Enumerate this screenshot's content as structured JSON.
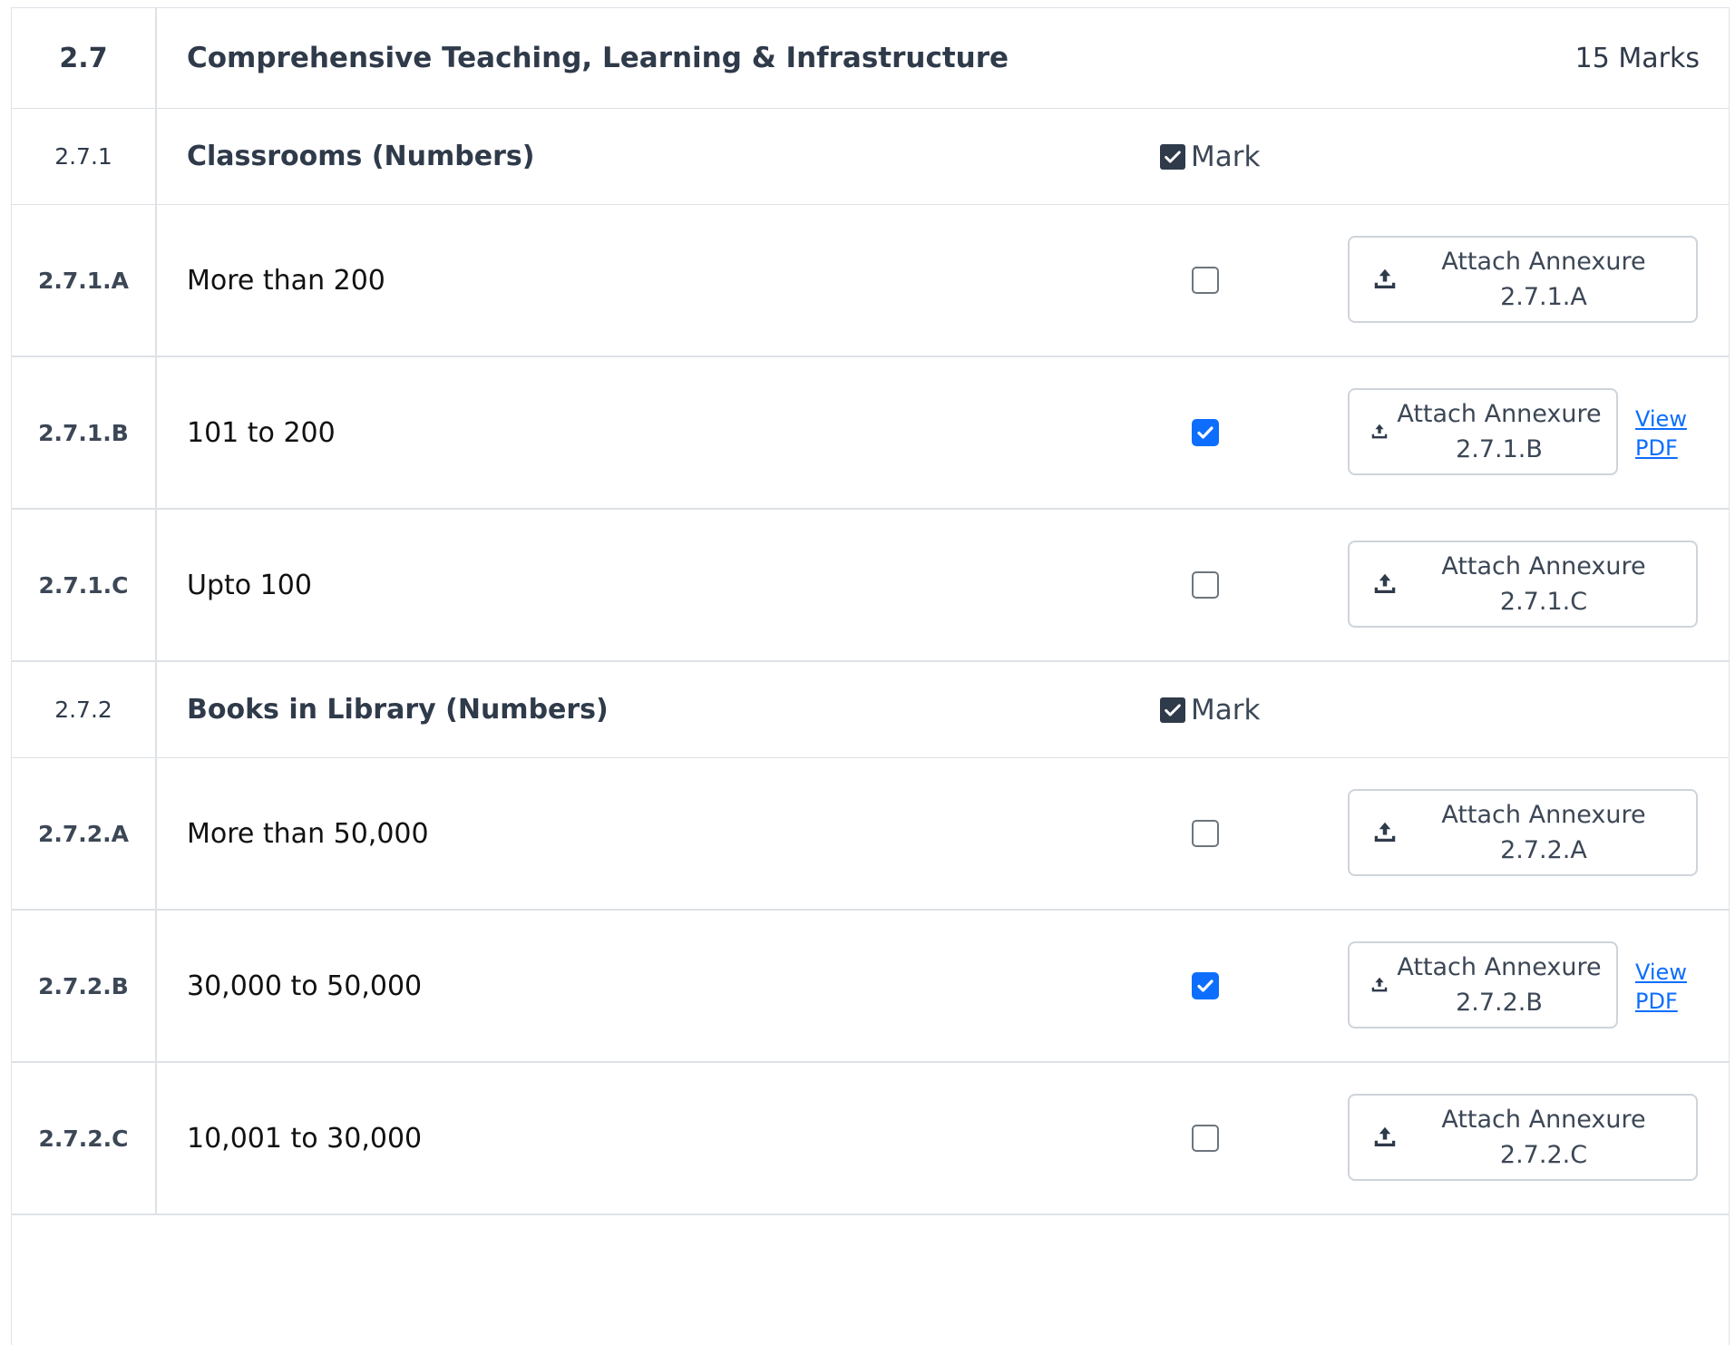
{
  "section": {
    "code": "2.7",
    "title": "Comprehensive Teaching, Learning & Infrastructure",
    "marks": "15 Marks"
  },
  "groups": [
    {
      "code": "2.7.1",
      "title": "Classrooms (Numbers)",
      "mark_label": "Mark",
      "mark_checked": true,
      "options": [
        {
          "code": "2.7.1.A",
          "label": "More than 200",
          "checked": false,
          "attach_label": "Attach Annexure",
          "attach_code": "2.7.1.A",
          "view_pdf": false
        },
        {
          "code": "2.7.1.B",
          "label": "101 to 200",
          "checked": true,
          "attach_label": "Attach Annexure",
          "attach_code": "2.7.1.B",
          "view_pdf": true,
          "view_label": "View",
          "pdf_label": "PDF"
        },
        {
          "code": "2.7.1.C",
          "label": "Upto 100",
          "checked": false,
          "attach_label": "Attach Annexure",
          "attach_code": "2.7.1.C",
          "view_pdf": false
        }
      ]
    },
    {
      "code": "2.7.2",
      "title": "Books in Library (Numbers)",
      "mark_label": "Mark",
      "mark_checked": true,
      "options": [
        {
          "code": "2.7.2.A",
          "label": "More than 50,000",
          "checked": false,
          "attach_label": "Attach Annexure",
          "attach_code": "2.7.2.A",
          "view_pdf": false
        },
        {
          "code": "2.7.2.B",
          "label": "30,000 to 50,000",
          "checked": true,
          "attach_label": "Attach Annexure",
          "attach_code": "2.7.2.B",
          "view_pdf": true,
          "view_label": "View",
          "pdf_label": "PDF"
        },
        {
          "code": "2.7.2.C",
          "label": "10,001 to 30,000",
          "checked": false,
          "attach_label": "Attach Annexure",
          "attach_code": "2.7.2.C",
          "view_pdf": false
        }
      ]
    }
  ],
  "colors": {
    "primary": "#0d6efd",
    "heading": "#2f3a4a",
    "border": "#dee2e6"
  },
  "icons": {
    "upload": "upload-icon",
    "check": "check-icon"
  }
}
